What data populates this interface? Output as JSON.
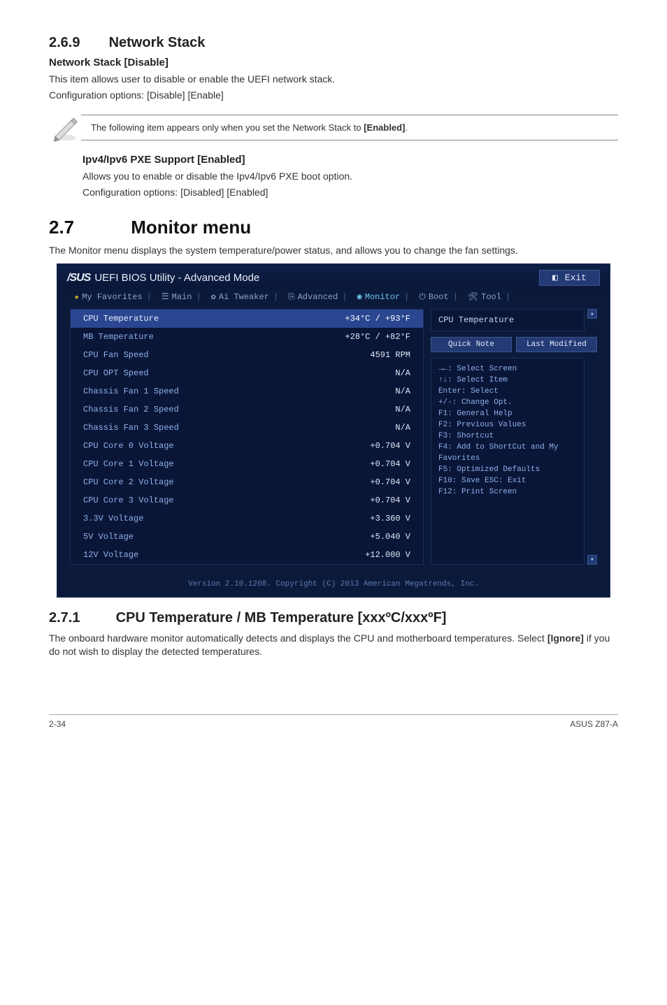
{
  "sections": {
    "s269": {
      "num": "2.6.9",
      "title": "Network Stack",
      "sub1_title": "Network Stack [Disable]",
      "sub1_l1": "This item allows user to disable or enable the UEFI network stack.",
      "sub1_l2": "Configuration options: [Disable] [Enable]",
      "note": "The following item appears only when you set the Network Stack to ",
      "note_bold": "[Enabled]",
      "note_tail": ".",
      "sub2_title": "Ipv4/Ipv6 PXE Support [Enabled]",
      "sub2_l1": "Allows you to enable or disable the Ipv4/Ipv6 PXE boot option.",
      "sub2_l2": "Configuration options: [Disabled] [Enabled]"
    },
    "s27": {
      "num": "2.7",
      "title": "Monitor menu",
      "intro": "The Monitor menu displays the system temperature/power status, and allows you to change the fan settings."
    },
    "s271": {
      "num": "2.7.1",
      "title": "CPU Temperature / MB Temperature [xxxºC/xxxºF]",
      "body1": "The onboard hardware monitor automatically detects and displays the CPU and motherboard temperatures. Select ",
      "body_bold": "[Ignore]",
      "body2": " if you do not wish to display the detected temperatures."
    }
  },
  "bios": {
    "brand": "/SUS",
    "product": "UEFI BIOS Utility - Advanced Mode",
    "exit": "Exit",
    "tabs": {
      "fav": "My Favorites",
      "main": "Main",
      "ai": "Ai Tweaker",
      "adv": "Advanced",
      "mon": "Monitor",
      "boot": "Boot",
      "tool": "Tool"
    },
    "rows": [
      {
        "label": "CPU Temperature",
        "value": "+34°C / +93°F",
        "sel": true
      },
      {
        "label": "MB Temperature",
        "value": "+28°C / +82°F"
      },
      {
        "label": "CPU Fan Speed",
        "value": "4591 RPM"
      },
      {
        "label": "CPU OPT Speed",
        "value": "N/A"
      },
      {
        "label": "Chassis Fan 1 Speed",
        "value": "N/A"
      },
      {
        "label": "Chassis Fan 2 Speed",
        "value": "N/A"
      },
      {
        "label": "Chassis Fan 3 Speed",
        "value": "N/A"
      },
      {
        "label": "CPU Core 0 Voltage",
        "value": "+0.704 V"
      },
      {
        "label": "CPU Core 1 Voltage",
        "value": "+0.704 V"
      },
      {
        "label": "CPU Core 2 Voltage",
        "value": "+0.704 V"
      },
      {
        "label": "CPU Core 3 Voltage",
        "value": "+0.704 V"
      },
      {
        "label": "3.3V Voltage",
        "value": "+3.360 V"
      },
      {
        "label": "5V Voltage",
        "value": "+5.040 V"
      },
      {
        "label": "12V Voltage",
        "value": "+12.000 V"
      }
    ],
    "help_title": "CPU Temperature",
    "quick_note": "Quick Note",
    "last_modified": "Last Modified",
    "hints": [
      "→←: Select Screen",
      "↑↓: Select Item",
      "Enter: Select",
      "+/-: Change Opt.",
      "F1: General Help",
      "F2: Previous Values",
      "F3: Shortcut",
      "F4: Add to ShortCut and My Favorites",
      "F5: Optimized Defaults",
      "F10: Save  ESC: Exit",
      "F12: Print Screen"
    ],
    "footer": "Version 2.10.1208. Copyright (C) 2013 American Megatrends, Inc."
  },
  "footer": {
    "left": "2-34",
    "right": "ASUS Z87-A"
  }
}
